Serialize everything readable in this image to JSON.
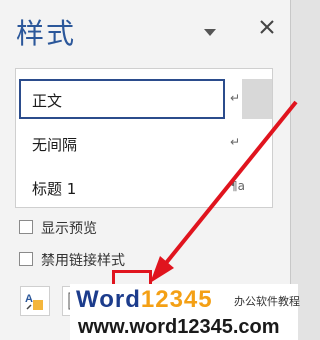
{
  "pane": {
    "title": "样式",
    "icons": {
      "options": "chevron-down-icon",
      "close": "close-icon"
    }
  },
  "style_list": {
    "items": [
      {
        "label": "正文",
        "mark": "↵",
        "selected": true
      },
      {
        "label": "无间隔",
        "mark": "↵",
        "selected": false
      },
      {
        "label": "标题 1",
        "mark": "¶a",
        "selected": false
      }
    ]
  },
  "options": {
    "show_preview": {
      "label": "显示预览",
      "checked": false
    },
    "disable_linked_styles": {
      "label": "禁用链接样式",
      "checked": false
    }
  },
  "footer_buttons": [
    "new-style-icon",
    "style-inspector-icon",
    "manage-styles-icon"
  ],
  "annotation": {
    "color": "#e0141e"
  },
  "watermark": {
    "brand_prefix": "Word",
    "brand_number": "12345",
    "brand_tagline": "办公软件教程",
    "url": "www.word12345.com"
  },
  "colors": {
    "accent": "#2b579a",
    "selection_border": "#2b4c8c",
    "watermark_blue": "#1c3c8c",
    "watermark_orange": "#f4a015"
  }
}
